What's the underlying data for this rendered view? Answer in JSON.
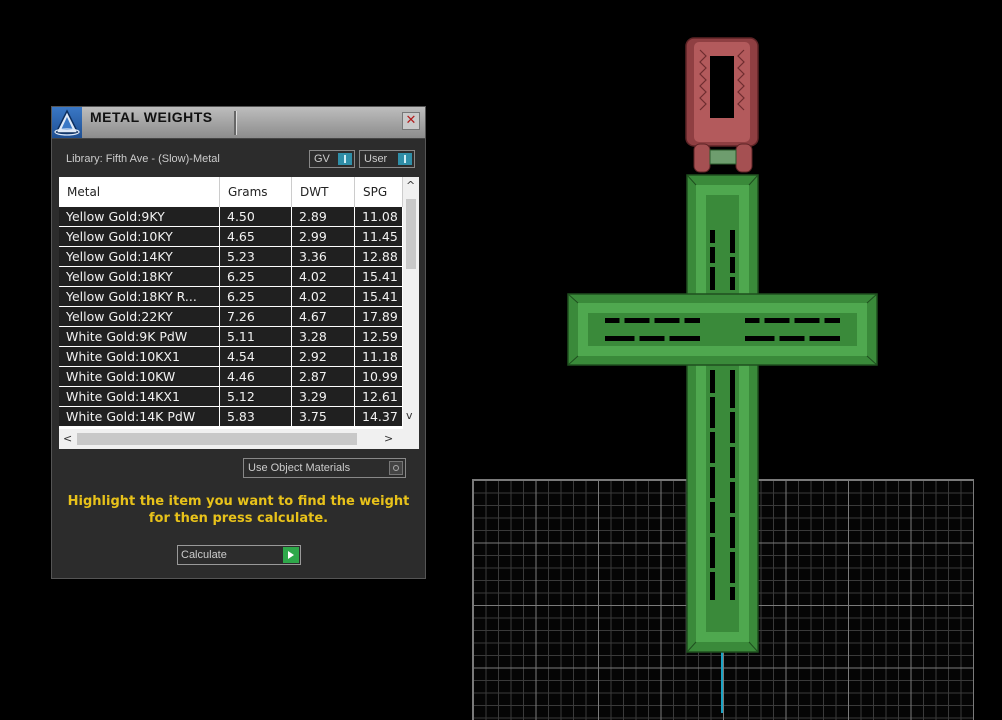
{
  "panel": {
    "title": "METAL WEIGHTS",
    "close_glyph": "✕",
    "logo_icon": "app-logo-icon",
    "library_label": "Library: Fifth Ave - (Slow)-Metal",
    "toggle_gv_label": "GV",
    "toggle_user_label": "User",
    "table": {
      "headers": [
        "Metal",
        "Grams",
        "DWT",
        "SPG"
      ],
      "rows": [
        [
          "Yellow Gold:9KY",
          "4.50",
          "2.89",
          "11.08"
        ],
        [
          "Yellow Gold:10KY",
          "4.65",
          "2.99",
          "11.45"
        ],
        [
          "Yellow Gold:14KY",
          "5.23",
          "3.36",
          "12.88"
        ],
        [
          "Yellow Gold:18KY",
          "6.25",
          "4.02",
          "15.41"
        ],
        [
          "Yellow Gold:18KY R...",
          "6.25",
          "4.02",
          "15.41"
        ],
        [
          "Yellow Gold:22KY",
          "7.26",
          "4.67",
          "17.89"
        ],
        [
          "White Gold:9K PdW",
          "5.11",
          "3.28",
          "12.59"
        ],
        [
          "White Gold:10KX1",
          "4.54",
          "2.92",
          "11.18"
        ],
        [
          "White Gold:10KW",
          "4.46",
          "2.87",
          "10.99"
        ],
        [
          "White Gold:14KX1",
          "5.12",
          "3.29",
          "12.61"
        ],
        [
          "White Gold:14K PdW",
          "5.83",
          "3.75",
          "14.37"
        ]
      ],
      "scroll_up": "^",
      "scroll_down": "v",
      "scroll_left": "<",
      "scroll_right": ">"
    },
    "use_object_materials_label": "Use Object Materials",
    "hint_text": "Highlight the item you want to find the weight for then press calculate.",
    "calculate_label": "Calculate"
  },
  "viewport": {
    "model": "cross-pendant",
    "colors": {
      "cross": "#3f8f3f",
      "bail": "#9e4a4a",
      "axis": "#1aa3c4",
      "hint": "#e8c21a"
    }
  }
}
